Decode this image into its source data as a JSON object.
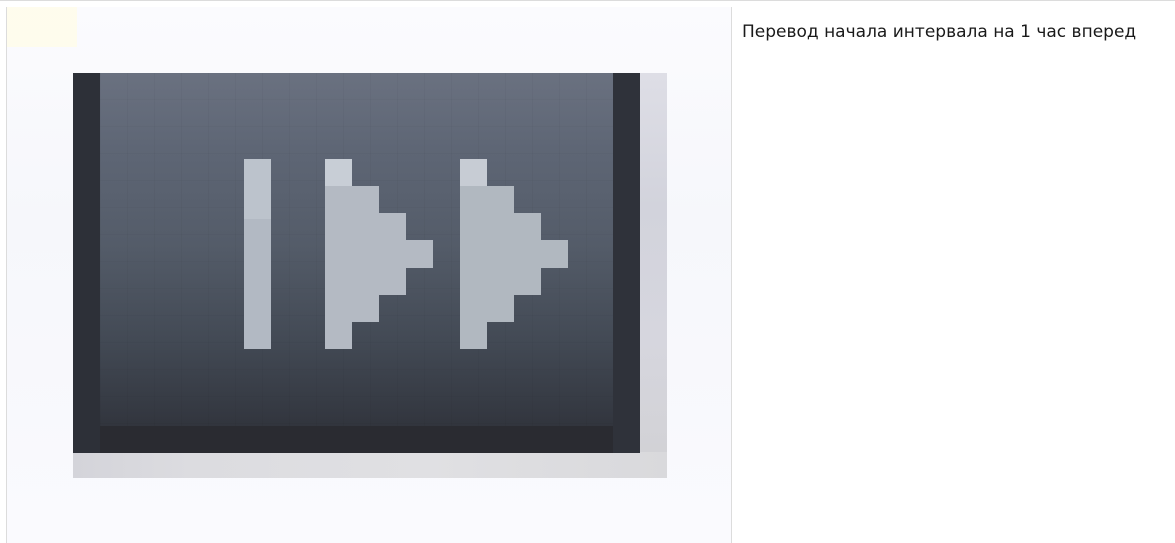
{
  "description": {
    "text": "Перевод начала интервала на 1 час вперед"
  },
  "icon": {
    "name": "skip-forward-icon",
    "colors": {
      "button_top": "#6a7180",
      "button_bottom": "#2b2d33",
      "glyph": "#b4bcc6"
    }
  }
}
